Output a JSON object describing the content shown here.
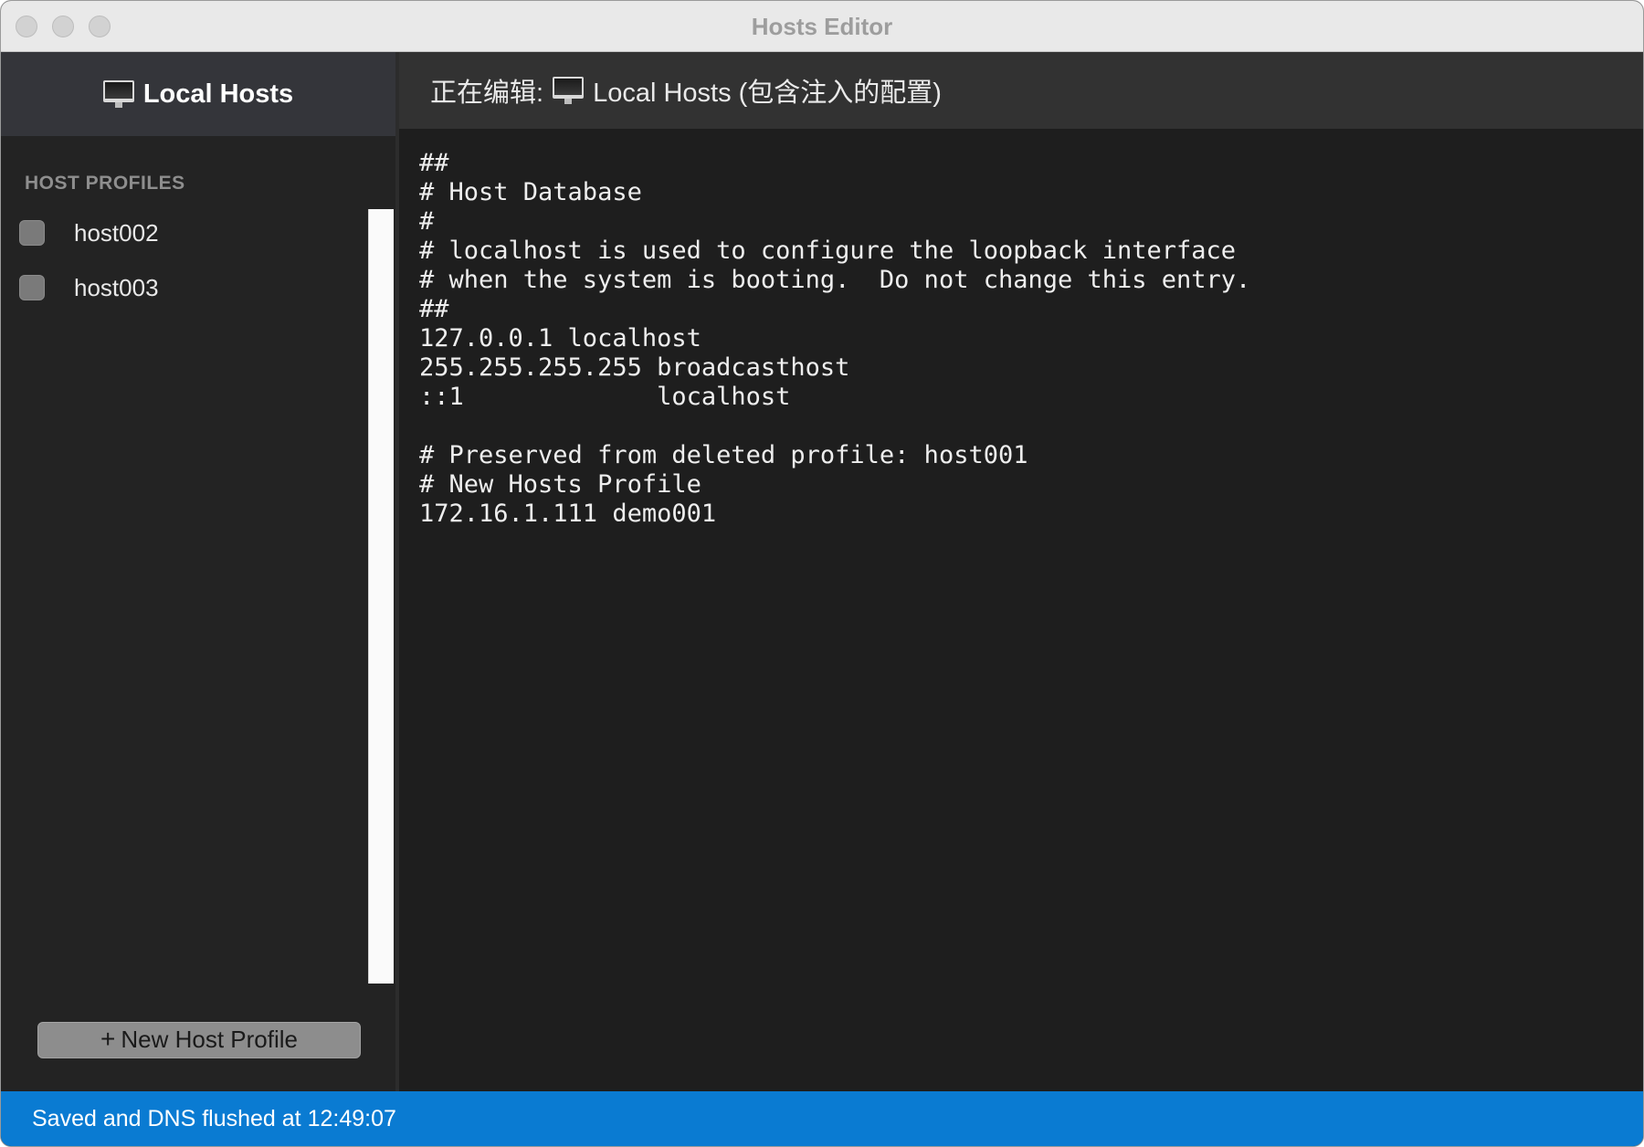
{
  "window": {
    "title": "Hosts Editor"
  },
  "sidebar": {
    "header_icon": "monitor-icon",
    "header_title": "Local Hosts",
    "section_label": "HOST PROFILES",
    "profiles": [
      {
        "name": "host002",
        "enabled": false
      },
      {
        "name": "host003",
        "enabled": false
      }
    ],
    "new_button_icon": "+",
    "new_button_label": "New Host Profile"
  },
  "editor": {
    "editing_prefix": "正在编辑:",
    "editing_icon": "monitor-icon",
    "editing_target": "Local Hosts (包含注入的配置)",
    "content": "##\n# Host Database\n#\n# localhost is used to configure the loopback interface\n# when the system is booting.  Do not change this entry.\n##\n127.0.0.1 localhost\n255.255.255.255 broadcasthost\n::1             localhost\n\n# Preserved from deleted profile: host001\n# New Hosts Profile\n172.16.1.111 demo001"
  },
  "status": {
    "message": "Saved and DNS flushed at 12:49:07",
    "color": "#0a7bd2"
  }
}
